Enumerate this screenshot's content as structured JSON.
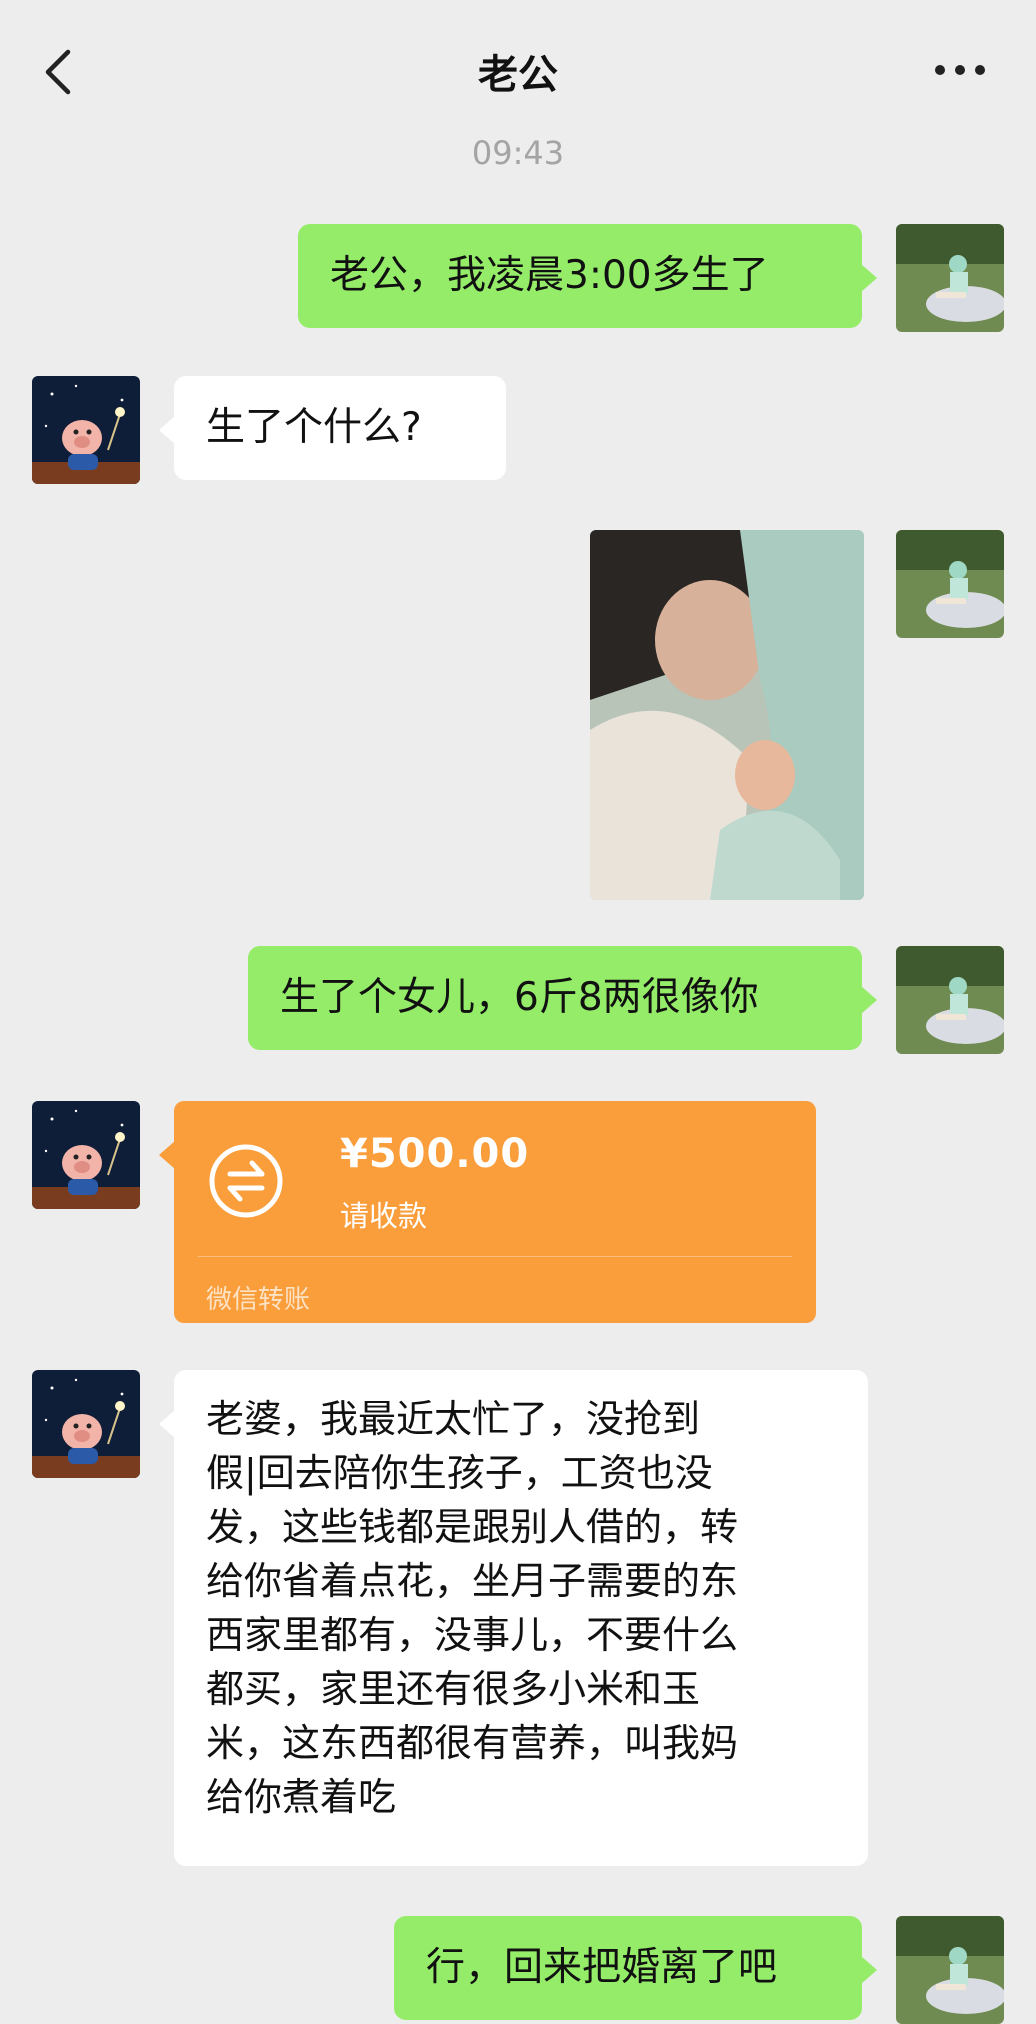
{
  "header": {
    "title": "老公",
    "icons": {
      "back": "chevron-left-icon",
      "more": "more-dots-icon"
    }
  },
  "timestamp": "09:43",
  "messages": [
    {
      "from": "me",
      "type": "text",
      "text": "老公，我凌晨3:00多生了"
    },
    {
      "from": "husband",
      "type": "text",
      "text": "生了个什么?"
    },
    {
      "from": "me",
      "type": "image",
      "description": "photo"
    },
    {
      "from": "me",
      "type": "text",
      "text": "生了个女儿，6斤8两很像你"
    },
    {
      "from": "husband",
      "type": "transfer",
      "amount": "¥500.00",
      "note": "请收款",
      "footer": "微信转账"
    },
    {
      "from": "husband",
      "type": "text",
      "text": "老婆，我最近太忙了，没抢到\n假|回去陪你生孩子，工资也没\n发，这些钱都是跟别人借的，转\n给你省着点花，坐月子需要的东\n西家里都有，没事儿，不要什么\n都买，家里还有很多小米和玉\n米，这东西都很有营养，叫我妈\n给你煮着吃"
    },
    {
      "from": "me",
      "type": "text",
      "text": "行，回来把婚离了吧"
    }
  ],
  "colors": {
    "background": "#ededed",
    "my_bubble": "#95ec69",
    "their_bubble": "#ffffff",
    "transfer": "#fa9d3b"
  }
}
